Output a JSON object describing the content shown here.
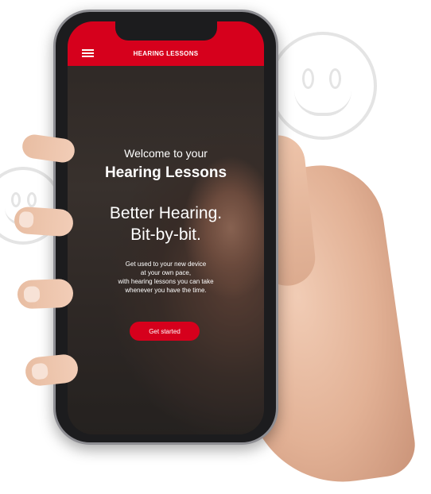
{
  "app_bar": {
    "title": "HEARING LESSONS",
    "menu_icon": "hamburger-menu-icon",
    "background_color": "#d6001c"
  },
  "welcome": {
    "intro": "Welcome to your",
    "product": "Hearing Lessons"
  },
  "headline": {
    "line1": "Better Hearing.",
    "line2": "Bit-by-bit."
  },
  "description": {
    "line1": "Get used to your new device",
    "line2": "at your own pace,",
    "line3": "with hearing lessons you can take",
    "line4": "whenever you have the time."
  },
  "cta": {
    "label": "Get started",
    "color": "#d6001c"
  },
  "decorations": {
    "smiley_icon": "smiley-face-icon"
  }
}
